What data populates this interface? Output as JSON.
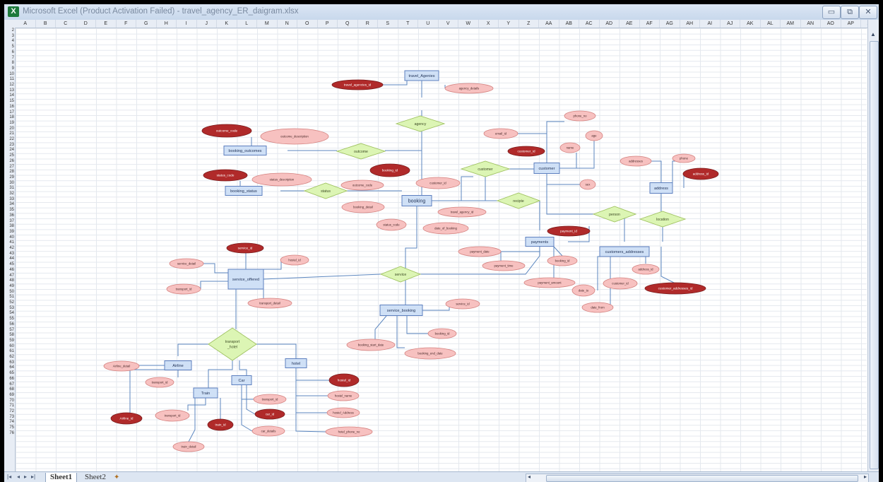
{
  "window": {
    "title": "Microsoft Excel (Product Activation Failed) - travel_agency_ER_daigram.xlsx",
    "app_icon": "excel-icon",
    "controls": {
      "minimize": "▭",
      "restore": "⧉",
      "close": "✕"
    }
  },
  "columns": [
    "A",
    "B",
    "C",
    "D",
    "E",
    "F",
    "G",
    "H",
    "I",
    "J",
    "K",
    "L",
    "M",
    "N",
    "O",
    "P",
    "Q",
    "R",
    "S",
    "T",
    "U",
    "V",
    "W",
    "X",
    "Y",
    "Z",
    "AA",
    "AB",
    "AC",
    "AD",
    "AE",
    "AF",
    "AG",
    "AH",
    "AI",
    "AJ",
    "AK",
    "AL",
    "AM",
    "AN",
    "AO",
    "AP",
    "AQ"
  ],
  "rows": [
    "2",
    "3",
    "4",
    "5",
    "6",
    "7",
    "8",
    "9",
    "10",
    "11",
    "12",
    "13",
    "14",
    "15",
    "16",
    "17",
    "18",
    "19",
    "20",
    "21",
    "22",
    "23",
    "24",
    "25",
    "26",
    "27",
    "28",
    "29",
    "30",
    "31",
    "32",
    "33",
    "34",
    "35",
    "36",
    "37",
    "38",
    "39",
    "40",
    "41",
    "42",
    "43",
    "44",
    "45",
    "46",
    "47",
    "48",
    "49",
    "50",
    "51",
    "52",
    "53",
    "54",
    "55",
    "56",
    "57",
    "58",
    "59",
    "60",
    "61",
    "62",
    "63",
    "64",
    "65",
    "66",
    "67",
    "68",
    "69",
    "70",
    "71",
    "72",
    "73",
    "74",
    "75",
    "76"
  ],
  "sheets": {
    "active": "Sheet1",
    "other": "Sheet2",
    "insert_icon": "insert-sheet-icon"
  },
  "colors": {
    "entity_fill": "#cfe0f6",
    "entity_stroke": "#5d7fbf",
    "rel_fill": "#dcf5b4",
    "rel_stroke": "#9fc260",
    "attr_fill": "#f7c1c0",
    "attr_stroke": "#d4817f",
    "key_fill": "#b02a2a",
    "connector": "#5b86bf"
  },
  "entities": [
    {
      "id": "travel_agencies",
      "label": "travel_Agenies"
    },
    {
      "id": "booking_outcomes",
      "label": "booking_outcomes"
    },
    {
      "id": "booking_status",
      "label": "booking_status"
    },
    {
      "id": "booking",
      "label": "booking"
    },
    {
      "id": "customer",
      "label": "customer"
    },
    {
      "id": "address",
      "label": "address"
    },
    {
      "id": "payments",
      "label": "payments"
    },
    {
      "id": "customers_addresses",
      "label": "customers_addresses"
    },
    {
      "id": "service_offered",
      "label": "service_offered"
    },
    {
      "id": "service_booking",
      "label": "service_booking"
    },
    {
      "id": "airline",
      "label": "Airline"
    },
    {
      "id": "hotel",
      "label": "hotel"
    },
    {
      "id": "car",
      "label": "Car"
    },
    {
      "id": "train",
      "label": "Train"
    }
  ],
  "relationships": [
    {
      "id": "agency",
      "label": "agency"
    },
    {
      "id": "outcome",
      "label": "outcome"
    },
    {
      "id": "status",
      "label": "status"
    },
    {
      "id": "customer_rel",
      "label": "customer"
    },
    {
      "id": "recipte",
      "label": "recipte"
    },
    {
      "id": "person",
      "label": "person"
    },
    {
      "id": "location",
      "label": "location"
    },
    {
      "id": "service",
      "label": "service"
    },
    {
      "id": "transport_hotel",
      "label": "transport\n_hotel"
    }
  ],
  "attributes": [
    {
      "id": "travel_agencies_id",
      "label": "travel_agencies_id",
      "key": true
    },
    {
      "id": "agency_details",
      "label": "agency_details",
      "key": false
    },
    {
      "id": "outcome_code",
      "label": "outcome_code",
      "key": true
    },
    {
      "id": "outcome_description",
      "label": "outcome_description",
      "key": false
    },
    {
      "id": "status_code",
      "label": "status_code",
      "key": true
    },
    {
      "id": "status_description",
      "label": "status_description",
      "key": false
    },
    {
      "id": "booking_id",
      "label": "booking_id",
      "key": true
    },
    {
      "id": "outcome_code_b",
      "label": "outcome_code",
      "key": false
    },
    {
      "id": "customer_id_b",
      "label": "customer_id",
      "key": false
    },
    {
      "id": "booking_detail",
      "label": "booking_detail",
      "key": false
    },
    {
      "id": "travel_agency_id",
      "label": "travel_agency_id",
      "key": false
    },
    {
      "id": "status_code_b",
      "label": "status_code",
      "key": false
    },
    {
      "id": "date_of_booking",
      "label": "date_of_booking",
      "key": false
    },
    {
      "id": "phone_no",
      "label": "phone_no",
      "key": false
    },
    {
      "id": "email_id",
      "label": "email_id",
      "key": false
    },
    {
      "id": "age",
      "label": "age",
      "key": false
    },
    {
      "id": "customer_id",
      "label": "customer_id",
      "key": true
    },
    {
      "id": "name",
      "label": "name",
      "key": false
    },
    {
      "id": "sex",
      "label": "sex",
      "key": false
    },
    {
      "id": "addresses",
      "label": "addresses",
      "key": false
    },
    {
      "id": "phone",
      "label": "phone",
      "key": false
    },
    {
      "id": "address_id",
      "label": "address_id",
      "key": true
    },
    {
      "id": "payment_id",
      "label": "payment_id",
      "key": true
    },
    {
      "id": "payment_date",
      "label": "payment_date",
      "key": false
    },
    {
      "id": "payment_time",
      "label": "payment_time",
      "key": false
    },
    {
      "id": "booking_id_p",
      "label": "booking_id",
      "key": false
    },
    {
      "id": "payment_amount",
      "label": "payment_amount",
      "key": false
    },
    {
      "id": "address_id_ca",
      "label": "address_id",
      "key": false
    },
    {
      "id": "customer_id_ca",
      "label": "customer_id",
      "key": false
    },
    {
      "id": "customer_addresses_id",
      "label": "customer_addresses_id",
      "key": true
    },
    {
      "id": "date_to",
      "label": "date_to",
      "key": false
    },
    {
      "id": "date_from",
      "label": "date_from",
      "key": false
    },
    {
      "id": "service_id",
      "label": "service_id",
      "key": true
    },
    {
      "id": "service_detail",
      "label": "service_detail",
      "key": false
    },
    {
      "id": "hostel_id_so",
      "label": "hostel_id",
      "key": false
    },
    {
      "id": "transport_id_so",
      "label": "transport_id",
      "key": false
    },
    {
      "id": "transport_detail",
      "label": "transport_detail",
      "key": false
    },
    {
      "id": "service_id_sb",
      "label": "service_id",
      "key": false
    },
    {
      "id": "booking_id_sb",
      "label": "booking_id",
      "key": false
    },
    {
      "id": "booking_start_date",
      "label": "booking_start_date",
      "key": false
    },
    {
      "id": "booking_end_date",
      "label": "booking_end_date",
      "key": false
    },
    {
      "id": "airline_detail",
      "label": "Airline_detail",
      "key": false
    },
    {
      "id": "transport_id_a",
      "label": "transport_id",
      "key": false
    },
    {
      "id": "airline_id",
      "label": "Airline_id",
      "key": true
    },
    {
      "id": "transport_id_t",
      "label": "transport_id",
      "key": false
    },
    {
      "id": "train_id",
      "label": "train_id",
      "key": true
    },
    {
      "id": "train_detail",
      "label": "train_detail",
      "key": false
    },
    {
      "id": "transport_id_c",
      "label": "transport_id",
      "key": false
    },
    {
      "id": "car_id",
      "label": "car_id",
      "key": true
    },
    {
      "id": "car_details",
      "label": "car_details",
      "key": false
    },
    {
      "id": "hostel_id",
      "label": "hostel_id",
      "key": true
    },
    {
      "id": "hostel_name",
      "label": "hostel_name",
      "key": false
    },
    {
      "id": "hostel_address",
      "label": "hostel_Address",
      "key": false
    },
    {
      "id": "hotel_phone_no",
      "label": "hotel_phone_no",
      "key": false
    }
  ]
}
